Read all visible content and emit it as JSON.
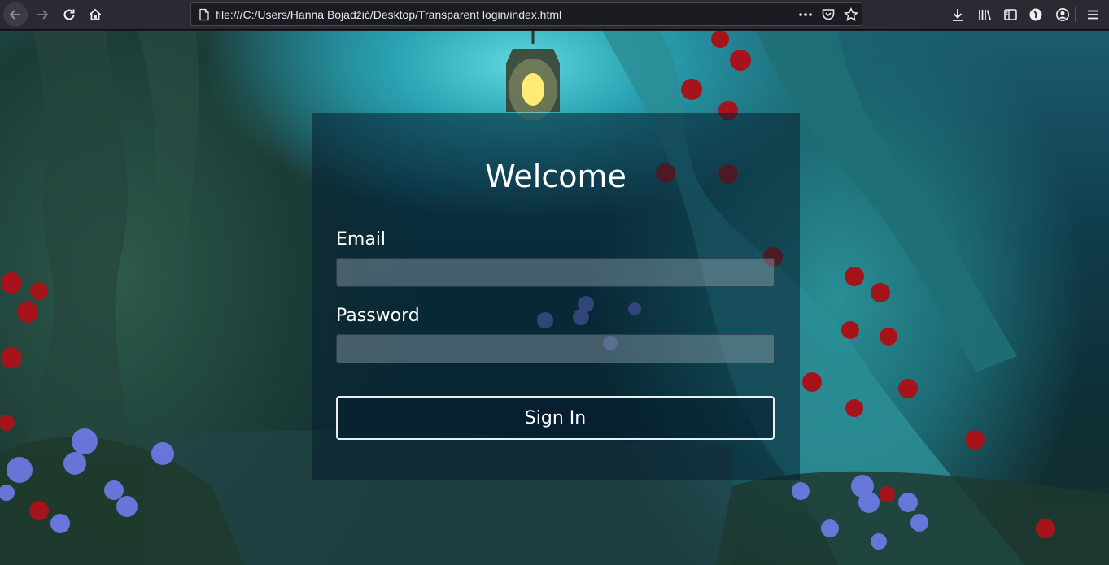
{
  "browser": {
    "url": "file:///C:/Users/Hanna Bojadžić/Desktop/Transparent login/index.html",
    "icons": {
      "back": "back-arrow-icon",
      "forward": "forward-arrow-icon",
      "reload": "reload-icon",
      "home": "home-icon",
      "page": "page-icon",
      "more": "more-dots-icon",
      "pocket": "pocket-icon",
      "bookmark": "star-icon",
      "downloads": "download-icon",
      "library": "library-icon",
      "sidebar": "sidebar-icon",
      "extension": "extension-icon",
      "account": "account-icon",
      "menu": "hamburger-menu-icon"
    }
  },
  "login": {
    "title": "Welcome",
    "email_label": "Email",
    "email_value": "",
    "password_label": "Password",
    "password_value": "",
    "submit_label": "Sign In"
  },
  "colors": {
    "chrome_bg": "#2b2a33",
    "urlbar_bg": "#1c1b22",
    "card_bg": "rgba(5,30,45,0.55)",
    "text": "#ffffff"
  }
}
